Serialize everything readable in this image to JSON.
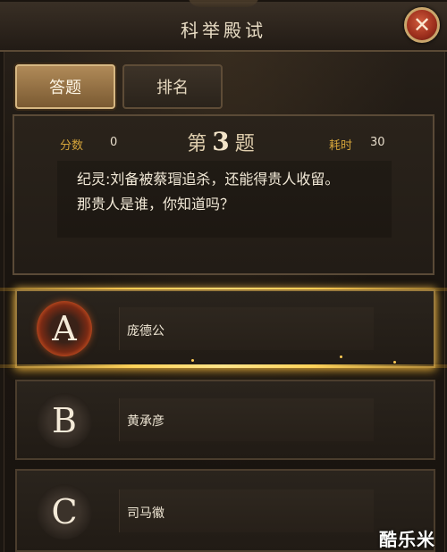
{
  "header": {
    "title": "科举殿试",
    "close_icon": "close-icon"
  },
  "tabs": [
    {
      "label": "答题",
      "active": true
    },
    {
      "label": "排名",
      "active": false
    }
  ],
  "question": {
    "score_label": "分数",
    "score_value": "0",
    "number_prefix": "第",
    "number": "3",
    "number_suffix": "题",
    "time_label": "耗时",
    "time_value": "30",
    "line1": "纪灵:刘备被蔡瑁追杀，还能得贵人收留。",
    "line2": "那贵人是谁，你知道吗？"
  },
  "options": [
    {
      "letter": "A",
      "text": "庞德公",
      "selected": true
    },
    {
      "letter": "B",
      "text": "黄承彦",
      "selected": false
    },
    {
      "letter": "C",
      "text": "司马徽",
      "selected": false
    }
  ],
  "watermark": "酷乐米",
  "colors": {
    "accent_gold": "#d4a43a",
    "close_red": "#b33a22",
    "selection_glow": "#ffd35a"
  }
}
